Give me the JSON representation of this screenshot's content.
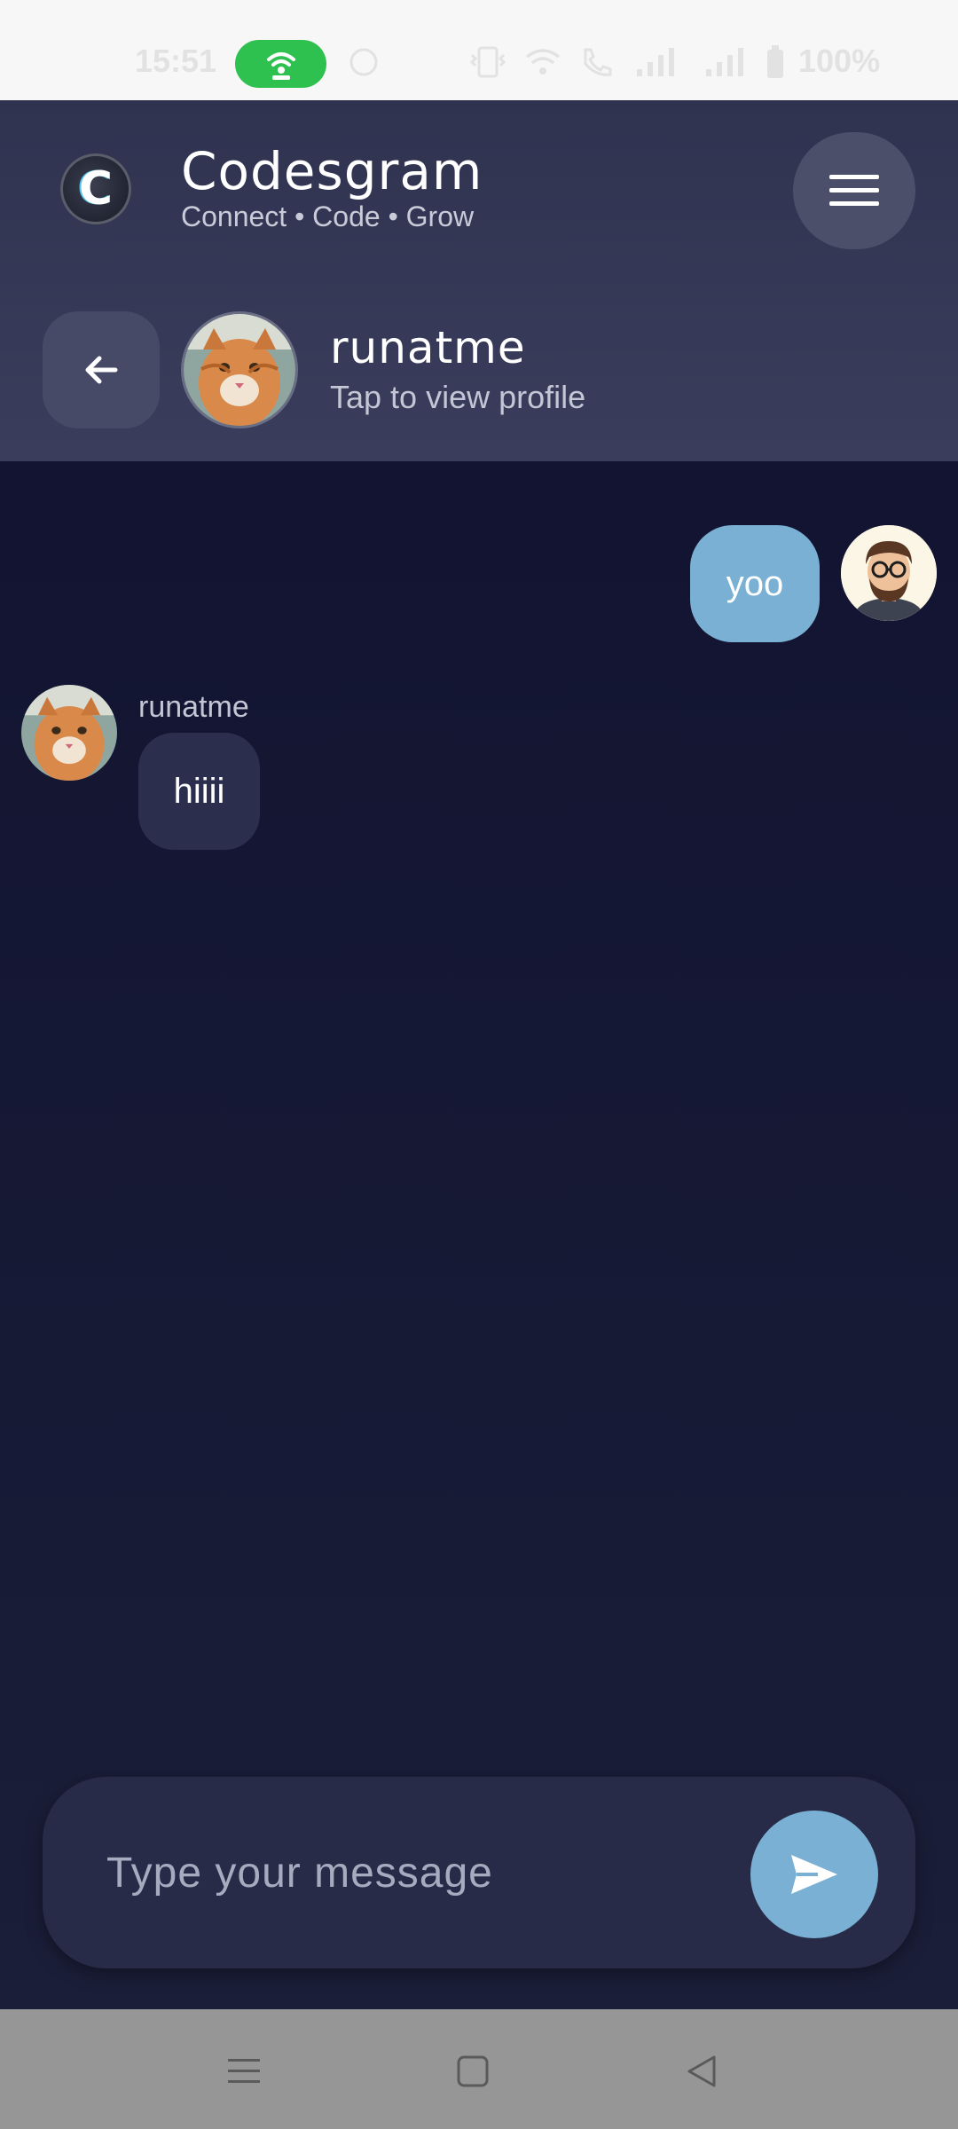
{
  "status_bar": {
    "time": "15:51",
    "battery_text": "100%",
    "icons": [
      "hotspot-icon",
      "whatsapp-icon",
      "vibrate-icon",
      "wifi-icon",
      "wifi-calling-icon",
      "signal-icon",
      "signal-icon",
      "battery-icon"
    ]
  },
  "app": {
    "logo_letter": "C",
    "title": "Codesgram",
    "tagline": "Connect • Code • Grow"
  },
  "chat_header": {
    "contact_name": "runatme",
    "subtitle": "Tap to view profile"
  },
  "messages": [
    {
      "direction": "outgoing",
      "text": "yoo"
    },
    {
      "direction": "incoming",
      "sender": "runatme",
      "text": "hiiii"
    }
  ],
  "composer": {
    "placeholder": "Type your message",
    "value": ""
  },
  "colors": {
    "accent": "#7ab0d4",
    "header_bg": "#363a58",
    "chat_bg": "#141730",
    "incoming_bubble": "#2b2f4d",
    "hotspot_green": "#2fc14f"
  }
}
